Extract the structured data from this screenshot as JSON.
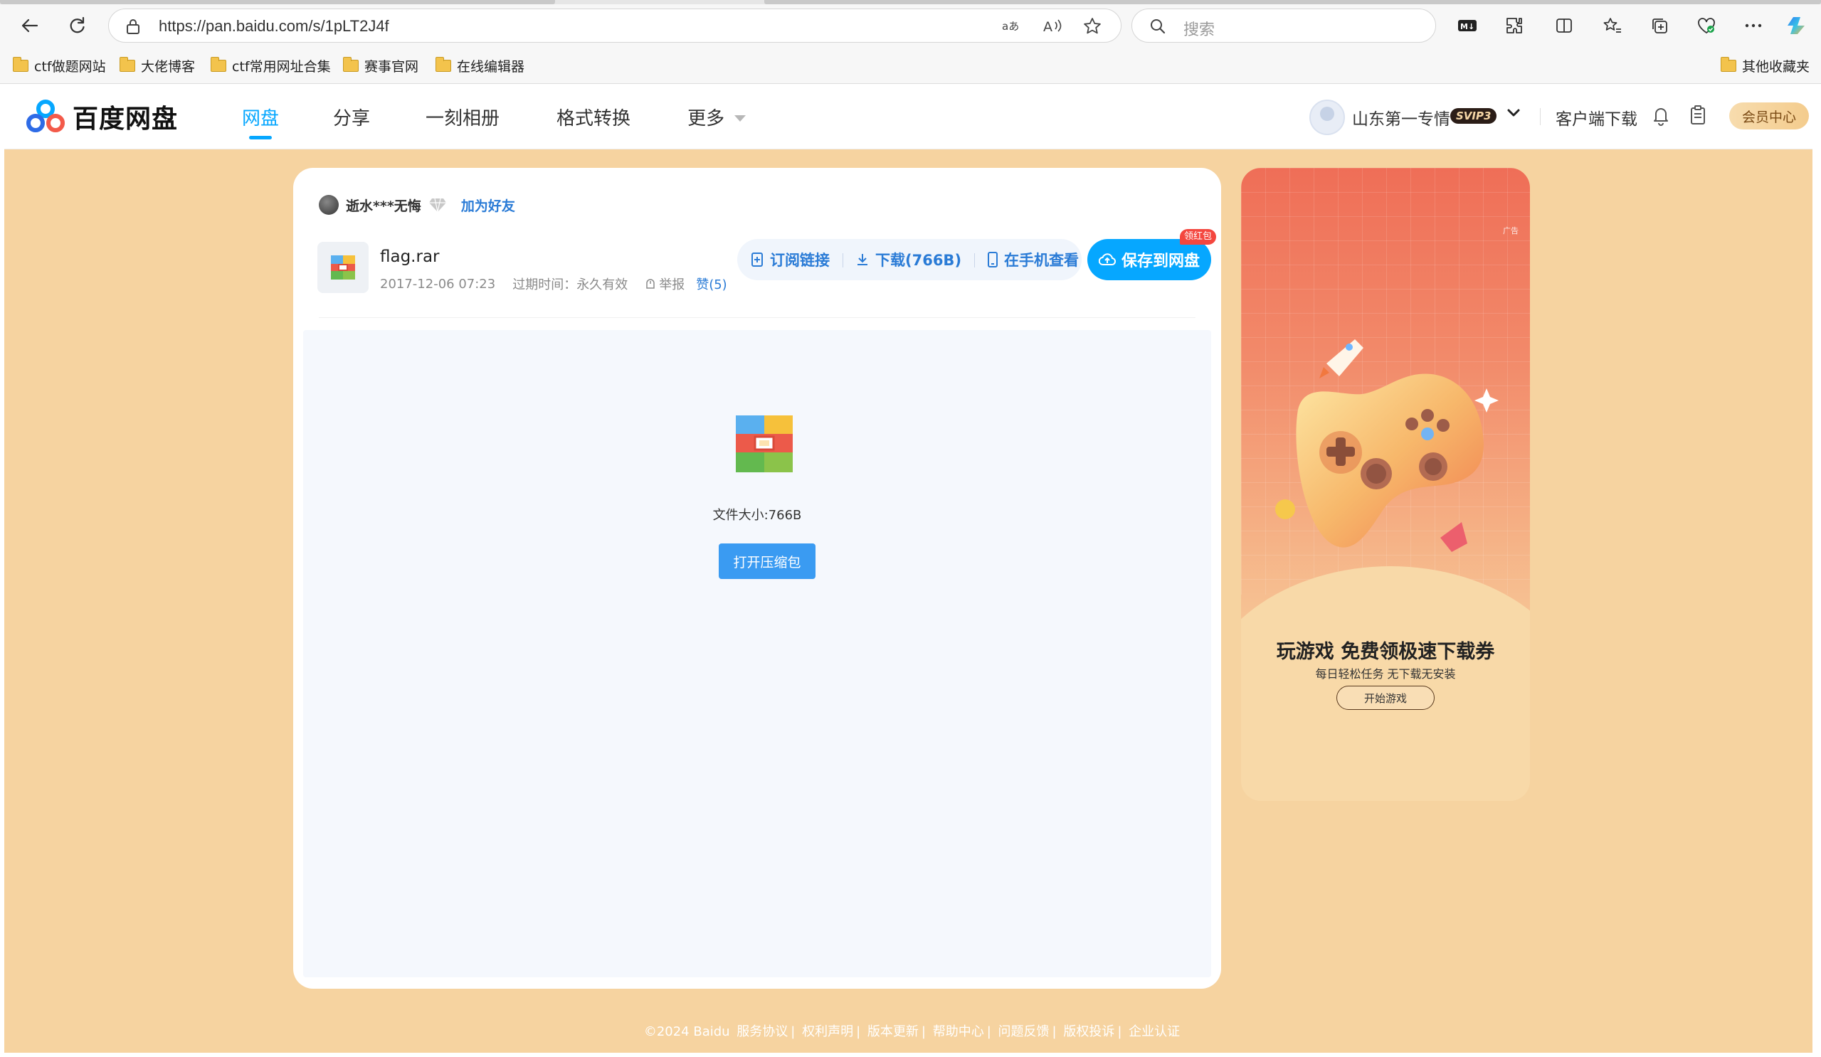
{
  "browser": {
    "url": "https://pan.baidu.com/s/1pLT2J4f",
    "search_placeholder": "搜索",
    "bookmarks": [
      "ctf做题网站",
      "大佬博客",
      "ctf常用网址合集",
      "赛事官网",
      "在线编辑器"
    ],
    "other_bookmarks": "其他收藏夹"
  },
  "header": {
    "logo": "百度网盘",
    "nav": [
      "网盘",
      "分享",
      "一刻相册",
      "格式转换",
      "更多"
    ],
    "username": "山东第一专情",
    "vip_badge": "SVIP3",
    "client_download": "客户端下载",
    "member_center": "会员中心"
  },
  "share": {
    "sharer_name": "逝水***无悔",
    "add_friend": "加为好友",
    "file_name": "flag.rar",
    "date": "2017-12-06 07:23",
    "expire_label": "过期时间：",
    "expire_value": "永久有效",
    "report": "举报",
    "likes": "赞(5)",
    "subscribe": "订阅链接",
    "download": "下载(766B)",
    "view_on_phone": "在手机查看",
    "save_to_disk": "保存到网盘",
    "red_packet": "领红包"
  },
  "preview": {
    "file_size": "文件大小:766B",
    "open_zip": "打开压缩包"
  },
  "ad": {
    "tag": "广告",
    "title": "玩游戏 免费领极速下载券",
    "subtitle": "每日轻松任务 无下载无安装",
    "button": "开始游戏"
  },
  "footer": {
    "copyright": "©2024 Baidu",
    "links": [
      "服务协议",
      "权利声明",
      "版本更新",
      "帮助中心",
      "问题反馈",
      "版权投诉",
      "企业认证"
    ]
  },
  "colors": {
    "accent": "#06a7ff",
    "link": "#2a7bd6",
    "page_bg": "#f6d3a0"
  }
}
